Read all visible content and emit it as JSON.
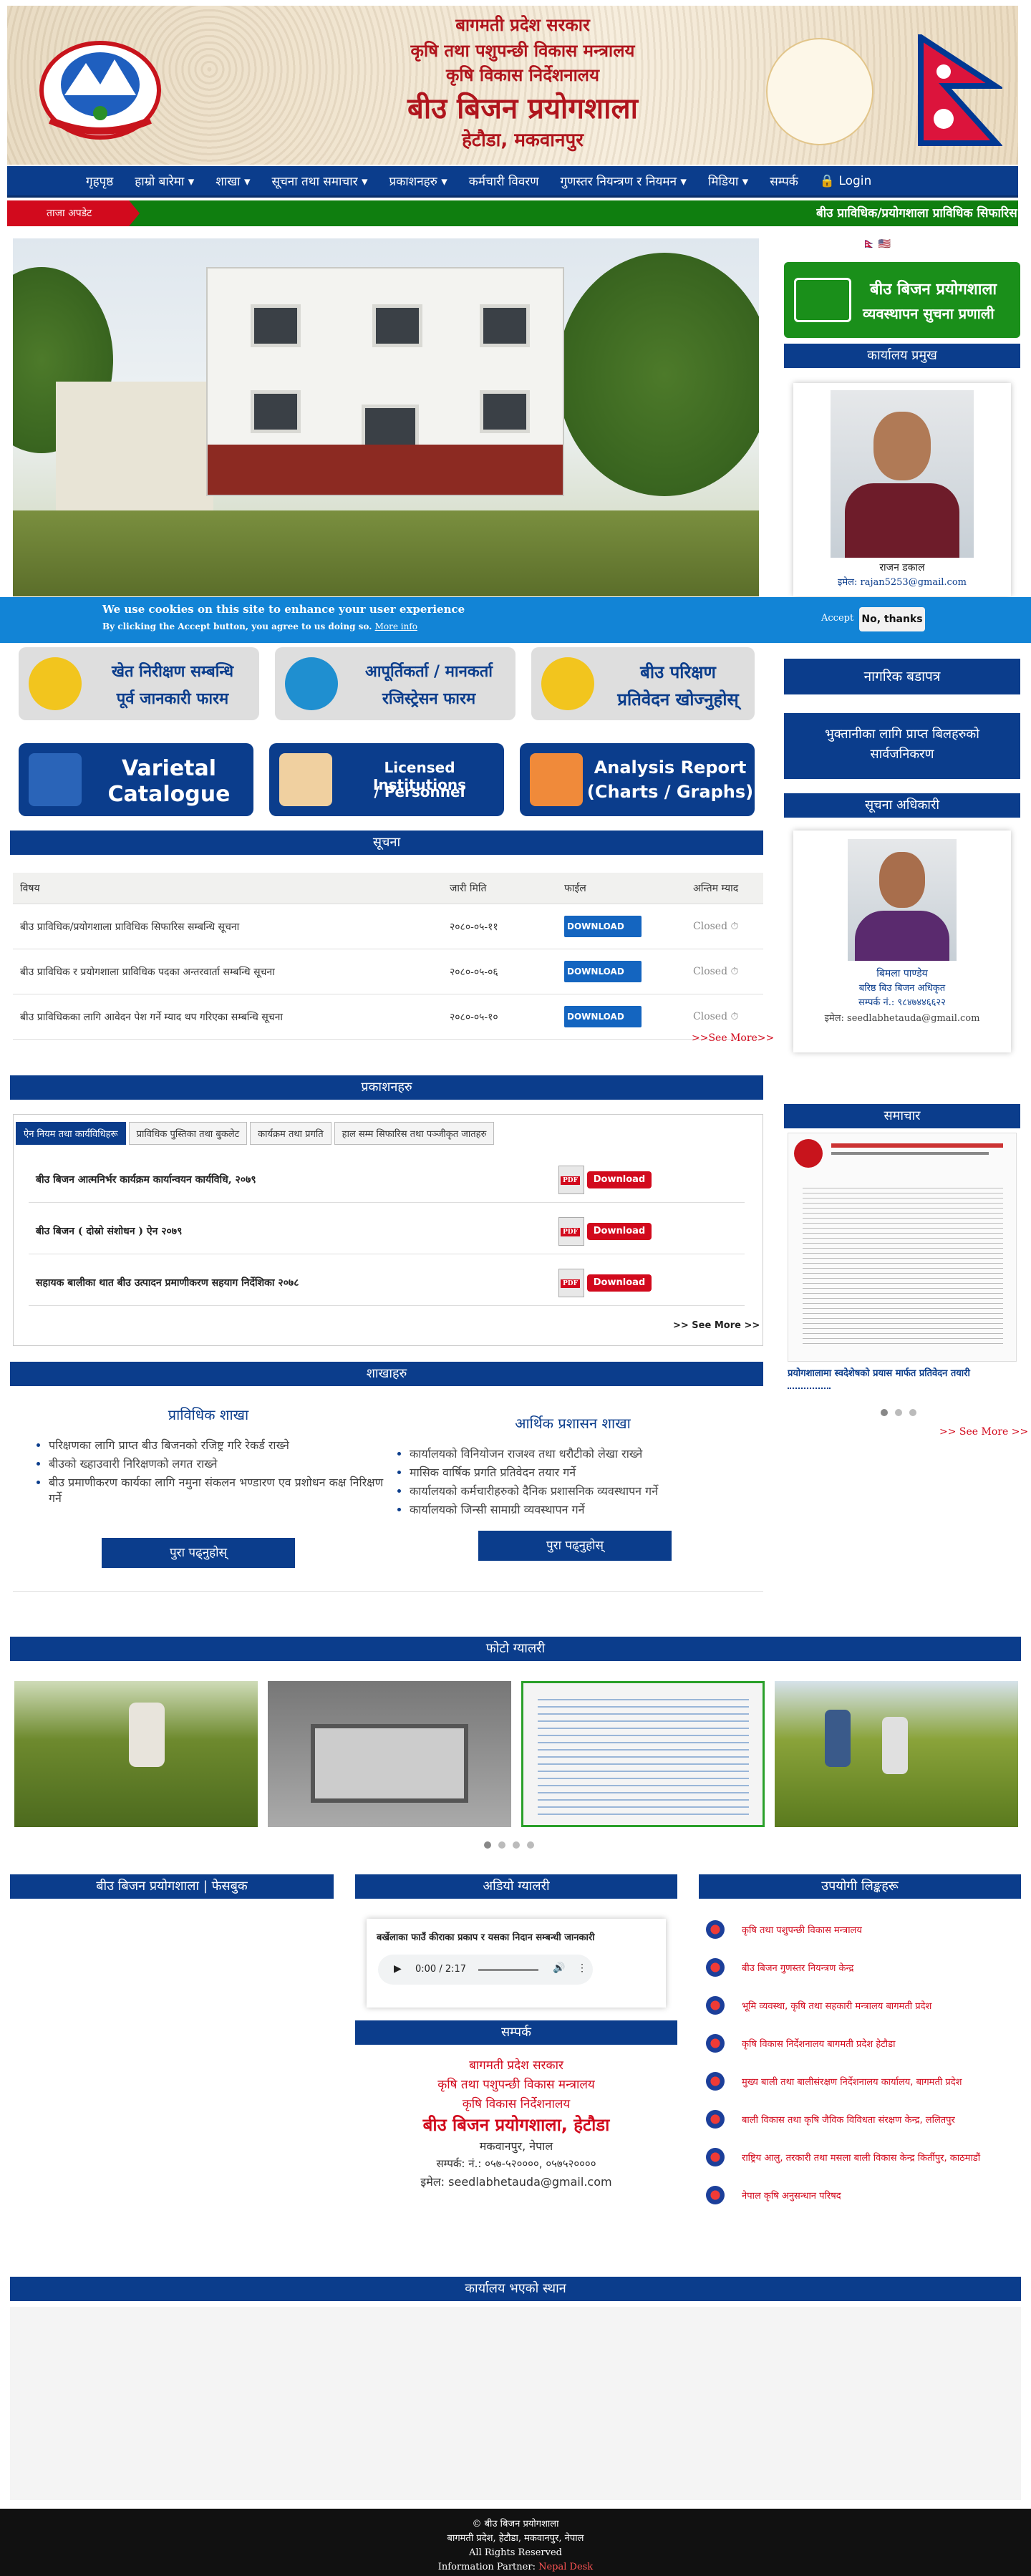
{
  "header": {
    "line1": "बागमती प्रदेश सरकार",
    "line2": "कृषि तथा पशुपन्छी विकास मन्त्रालय",
    "line3": "कृषि विकास निर्देशनालय",
    "line4": "बीउ बिजन प्रयोगशाला",
    "line5": "हेटौडा, मकवानपुर"
  },
  "nav": {
    "items": [
      "गृहपृष्ठ",
      "हाम्रो बारेमा ▾",
      "शाखा ▾",
      "सूचना तथा समाचार ▾",
      "प्रकाशनहरु ▾",
      "कर्मचारी विवरण",
      "गुणस्तर नियन्त्रण र नियमन ▾",
      "मिडिया ▾",
      "सम्पर्क",
      "🔒 Login"
    ]
  },
  "ticker": {
    "label": "ताजा अपडेट",
    "text": "बीउ प्राविधिक/प्रयोगशाला प्राविधिक सिफारिस"
  },
  "lang": {
    "ne": "🇳🇵",
    "en": "🇺🇸"
  },
  "ims": {
    "line1": "बीउ बिजन प्रयोगशाला",
    "line2": "व्यवस्थापन सुचना प्रणाली"
  },
  "chief": {
    "heading": "कार्यालय प्रमुख",
    "name": "राजन डकाल",
    "email": "इमेल: rajan5253@gmail.com"
  },
  "cookie": {
    "title": "We use cookies on this site to enhance your user experience",
    "text": "By clicking the Accept button, you agree to us doing so.",
    "more": "More info",
    "accept": "Accept",
    "no": "No, thanks"
  },
  "quick": {
    "q1a": "खेत निरीक्षण सम्बन्धि",
    "q1b": "पूर्व जानकारी फारम",
    "q2a": "आपूर्तिकर्ता / मानकर्ता",
    "q2b": "रजिस्ट्रेसन फारम",
    "q3a": "बीउ परिक्षण",
    "q3b": "प्रतिवेदन खोज्नुहोस्",
    "q4a": "Varietal",
    "q4b": "Catalogue",
    "q5a": "Licensed Institutions",
    "q5b": "/ Personnel",
    "q6a": "Analysis Report",
    "q6b": "(Charts / Graphs)"
  },
  "sidebar": {
    "citizen": "नागरिक बडापत्र",
    "payment1": "भुक्तानीका लागि प्राप्त बिलहरुको",
    "payment2": "सार्वजनिकरण",
    "info_heading": "सूचना अधिकारी",
    "info_name": "बिमला पाण्डेय",
    "info_role": "बरिष्ठ बिउ बिजन अधिकृत",
    "info_phone": "सम्पर्क नं.: ९८४७४४६६२२",
    "info_email": "इमेल: seedlabhetauda@gmail.com",
    "news_heading": "समाचार",
    "news_caption": "प्रयोगशालामा स्वदेशेषको प्रयास मार्फत प्रतिवेदन तयारी",
    "news_more": ">> See More >>"
  },
  "notices": {
    "heading": "सूचना",
    "cols": [
      "विषय",
      "जारी मिति",
      "फाईल",
      "अन्तिम म्याद"
    ],
    "rows": [
      {
        "subject": "बीउ प्राविधिक/प्रयोगशाला प्राविधिक सिफारिस सम्बन्धि सूचना",
        "date": "२०८०-०५-११",
        "status": "Closed ⏱"
      },
      {
        "subject": "बीउ प्राविधिक र प्रयोगशाला प्राविधिक पदका अन्तरवार्ता सम्बन्धि सूचना",
        "date": "२०८०-०५-०६",
        "status": "Closed ⏱"
      },
      {
        "subject": "बीउ प्राविधिकका लागि आवेदन पेश गर्ने म्याद थप गरिएका सम्बन्धि सूचना",
        "date": "२०८०-०५-१०",
        "status": "Closed ⏱"
      }
    ],
    "download": "DOWNLOAD",
    "more": ">>See More>>"
  },
  "pubs": {
    "heading": "प्रकाशनहरु",
    "tabs": [
      "ऐन नियम तथा कार्यविधिहरू",
      "प्राविधिक पुस्तिका तथा बुकलेट",
      "कार्यक्रम तथा प्रगति",
      "हाल सम्म सिफारिस तथा पञ्जीकृत जातहरु"
    ],
    "items": [
      "बीउ बिजन आत्मनिर्भर कार्यक्रम कार्यान्वयन कार्यविधि, २०७९",
      "बीउ बिजन ( दोस्रो संशोधन ) ऐन २०७९",
      "सहायक बालीका थात बीउ उत्पादन प्रमाणीकरण सहयाग निर्देशिका २०७८"
    ],
    "download": "Download",
    "more": ">> See More >>"
  },
  "branches": {
    "heading": "शाखाहरु",
    "b1": {
      "title": "प्राविधिक शाखा",
      "items": [
        "परिक्षणका लागि प्राप्त बीउ बिजनको रजिष्ट्र गरि रेकर्ड राख्ने",
        "बीउको ख्हाउवारी निरिक्षणको लगत राख्ने",
        "बीउ प्रमाणीकरण कार्यका लागि नमुना संकलन भण्डारण एव प्रशोधन कक्ष निरिक्षण गर्ने"
      ],
      "btn": "पुरा पढ्नुहोस्"
    },
    "b2": {
      "title": "आर्थिक प्रशासन शाखा",
      "items": [
        "कार्यालयको विनियोजन राजश्व तथा धरौटीको लेखा राख्ने",
        "मासिक वार्षिक प्रगति प्रतिवेदन तयार गर्ने",
        "कार्यालयको कर्मचारीहरुको दैनिक प्रशासनिक व्यवस्थापन गर्ने",
        "कार्यालयको जिन्सी सामाग्री व्यवस्थापन गर्ने"
      ],
      "btn": "पुरा पढ्नुहोस्"
    }
  },
  "gallery": {
    "heading": "फोटो ग्यालरी"
  },
  "bottom": {
    "fb": "बीउ बिजन प्रयोगशाला | फेसबुक",
    "video": "अडियो ग्यालरी",
    "audio_title": "बर्खेलाका फाउँ कीराका प्रकाप र यसका निदान सम्बन्धी जानकारी",
    "audio_time": "0:00 / 2:17",
    "contact": "सम्पर्क",
    "c1": "बागमती प्रदेश सरकार",
    "c2": "कृषि तथा पशुपन्छी विकास मन्त्रालय",
    "c3": "कृषि विकास निर्देशनालय",
    "c4": "बीउ बिजन प्रयोगशाला, हेटौडा",
    "c5": "मकवानपुर, नेपाल",
    "c6": "सम्पर्क: नं.: ०५७-५२००००, ०५७५२००००",
    "c7": "इमेल: seedlabhetauda@gmail.com",
    "links_heading": "उपयोगी लिङ्कहरू",
    "links": [
      "कृषि तथा पशुपन्छी विकास मन्त्रालय",
      "बीउ बिजन गुणस्तर नियन्त्रण केन्द्र",
      "भूमि व्यवस्था, कृषि तथा सहकारी मन्त्रालय बागमती प्रदेश",
      "कृषि विकास निर्देशनालय बागमती प्रदेश हेटौडा",
      "मुख्य बाली तथा बालीसंरक्षण निर्देशनालय कार्यालय, बागमती प्रदेश",
      "बाली विकास तथा कृषि जैविक विविधता संरक्षण केन्द्र, ललितपुर",
      "राष्ट्रिय आलु, तरकारी तथा मसला बाली विकास केन्द्र किर्तीपुर, काठमाडौं",
      "नेपाल कृषि अनुसन्धान परिषद"
    ],
    "map": "कार्यालय भएको स्थान"
  },
  "footer": {
    "l1": "© बीउ बिजन प्रयोगशाला",
    "l2": "बागमती प्रदेश, हेटौडा, मकवानपुर, नेपाल",
    "l3": "All Rights Reserved",
    "l4": "Information Partner:",
    "l5": "Nepal Desk"
  },
  "colors": {
    "primary": "#0b3d8c",
    "accent": "#d20a1d",
    "green": "#0f7e0f"
  }
}
